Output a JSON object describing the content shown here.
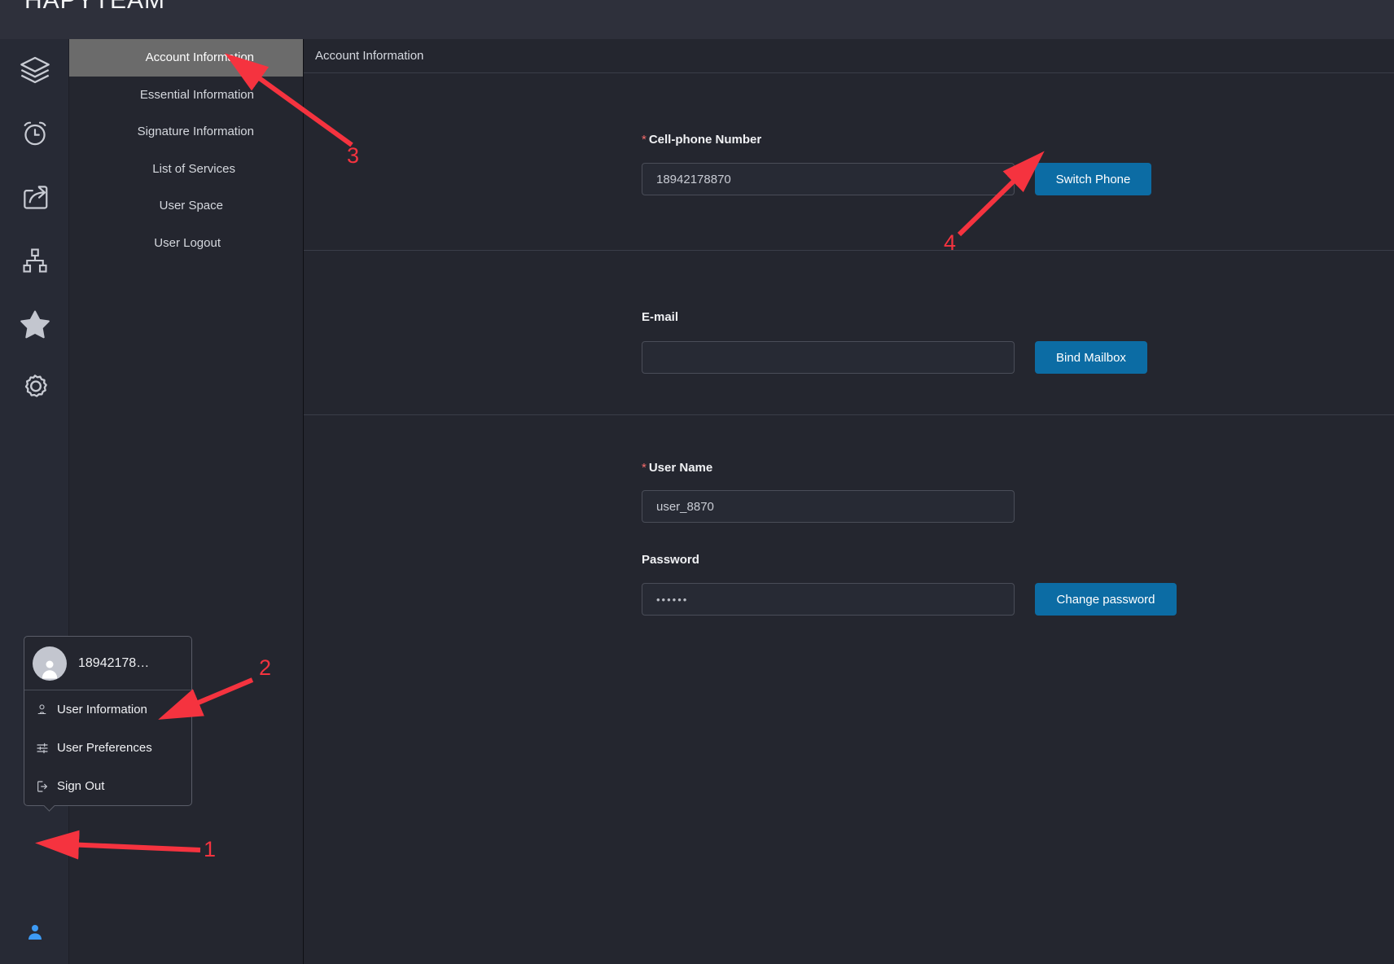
{
  "app": {
    "brand": "HAPYTEAM",
    "accent_blue": "#0c6ca4",
    "panel_bg": "#24262f",
    "topbar_bg": "#2e303b",
    "active_menu_bg": "#6b6b6b",
    "annotation_color": "#f5333f"
  },
  "rail": {
    "icons": [
      {
        "name": "layers-icon",
        "label": "Layers"
      },
      {
        "name": "alarm-clock-icon",
        "label": "Alarm Clock"
      },
      {
        "name": "share-export-icon",
        "label": "Share"
      },
      {
        "name": "sitemap-icon",
        "label": "Sitemap"
      },
      {
        "name": "star-icon",
        "label": "Favorites"
      },
      {
        "name": "gear-icon",
        "label": "Settings"
      }
    ],
    "user_icon": {
      "name": "user-icon",
      "label": "User",
      "color": "#3d9bf5"
    }
  },
  "menu": {
    "items": [
      {
        "label": "Account Information",
        "active": true
      },
      {
        "label": "Essential Information",
        "active": false
      },
      {
        "label": "Signature Information",
        "active": false
      },
      {
        "label": "List of Services",
        "active": false
      },
      {
        "label": "User Space",
        "active": false
      },
      {
        "label": "User Logout",
        "active": false
      }
    ]
  },
  "content": {
    "header_title": "Account Information",
    "sections": {
      "phone": {
        "label": "Cell-phone Number",
        "required": true,
        "value": "18942178870",
        "placeholder": "",
        "button": "Switch Phone"
      },
      "email": {
        "label": "E-mail",
        "required": false,
        "value": "",
        "placeholder": "",
        "button": "Bind Mailbox"
      },
      "username": {
        "label": "User Name",
        "required": true,
        "value": "user_8870",
        "placeholder": ""
      },
      "password": {
        "label": "Password",
        "required": false,
        "value": "••••••",
        "placeholder": "",
        "button": "Change password"
      }
    }
  },
  "user_popup": {
    "account_name": "18942178…",
    "items": [
      {
        "label": "User Information",
        "icon": "user-outline-icon"
      },
      {
        "label": "User Preferences",
        "icon": "sliders-icon"
      },
      {
        "label": "Sign Out",
        "icon": "logout-icon"
      }
    ]
  },
  "annotations": {
    "markers": [
      {
        "id": "1",
        "text": "1"
      },
      {
        "id": "2",
        "text": "2"
      },
      {
        "id": "3",
        "text": "3"
      },
      {
        "id": "4",
        "text": "4"
      }
    ]
  }
}
